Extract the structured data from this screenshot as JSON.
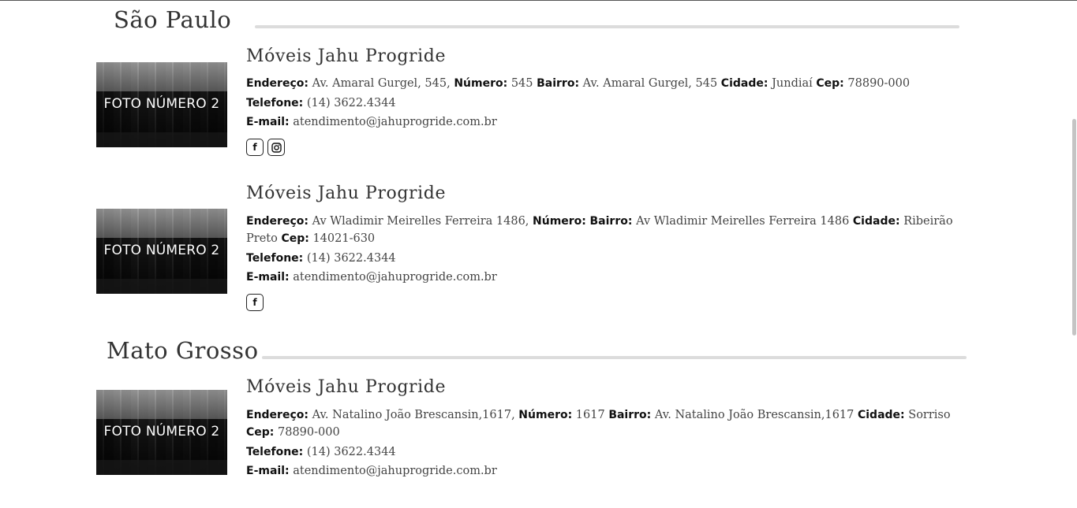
{
  "regions": [
    {
      "title": "São Paulo"
    },
    {
      "title": "Mato Grosso"
    }
  ],
  "labels": {
    "endereco": "Endereço:",
    "numero": "Número:",
    "bairro": "Bairro:",
    "cidade": "Cidade:",
    "cep": "Cep:",
    "telefone": "Telefone:",
    "email": "E-mail:"
  },
  "stores": [
    {
      "photo_label": "FOTO NÚMERO 2",
      "name": "Móveis Jahu Progride",
      "endereco": "Av. Amaral Gurgel, 545,",
      "numero": "545",
      "bairro": "Av. Amaral Gurgel, 545",
      "cidade": "Jundiaí",
      "cep": "78890-000",
      "telefone": "(14) 3622.4344",
      "email": "atendimento@jahuprogride.com.br",
      "social": [
        "facebook-icon",
        "instagram-icon"
      ]
    },
    {
      "photo_label": "FOTO NÚMERO 2",
      "name": "Móveis Jahu Progride",
      "endereco": "Av Wladimir Meirelles Ferreira 1486,",
      "numero": "",
      "bairro": "Av Wladimir Meirelles Ferreira 1486",
      "cidade": "Ribeirão Preto",
      "cep": "14021-630",
      "telefone": "(14) 3622.4344",
      "email": "atendimento@jahuprogride.com.br",
      "social": [
        "facebook-icon"
      ]
    },
    {
      "photo_label": "FOTO NÚMERO 2",
      "name": "Móveis Jahu Progride",
      "endereco": "Av. Natalino João Brescansin,1617,",
      "numero": "1617",
      "bairro": "Av. Natalino João Brescansin,1617",
      "cidade": "Sorriso",
      "cep": "78890-000",
      "telefone": "(14) 3622.4344",
      "email": "atendimento@jahuprogride.com.br",
      "social": []
    }
  ],
  "colors": {
    "divider": "#dcdcdc",
    "text": "#333333",
    "label": "#111111"
  }
}
